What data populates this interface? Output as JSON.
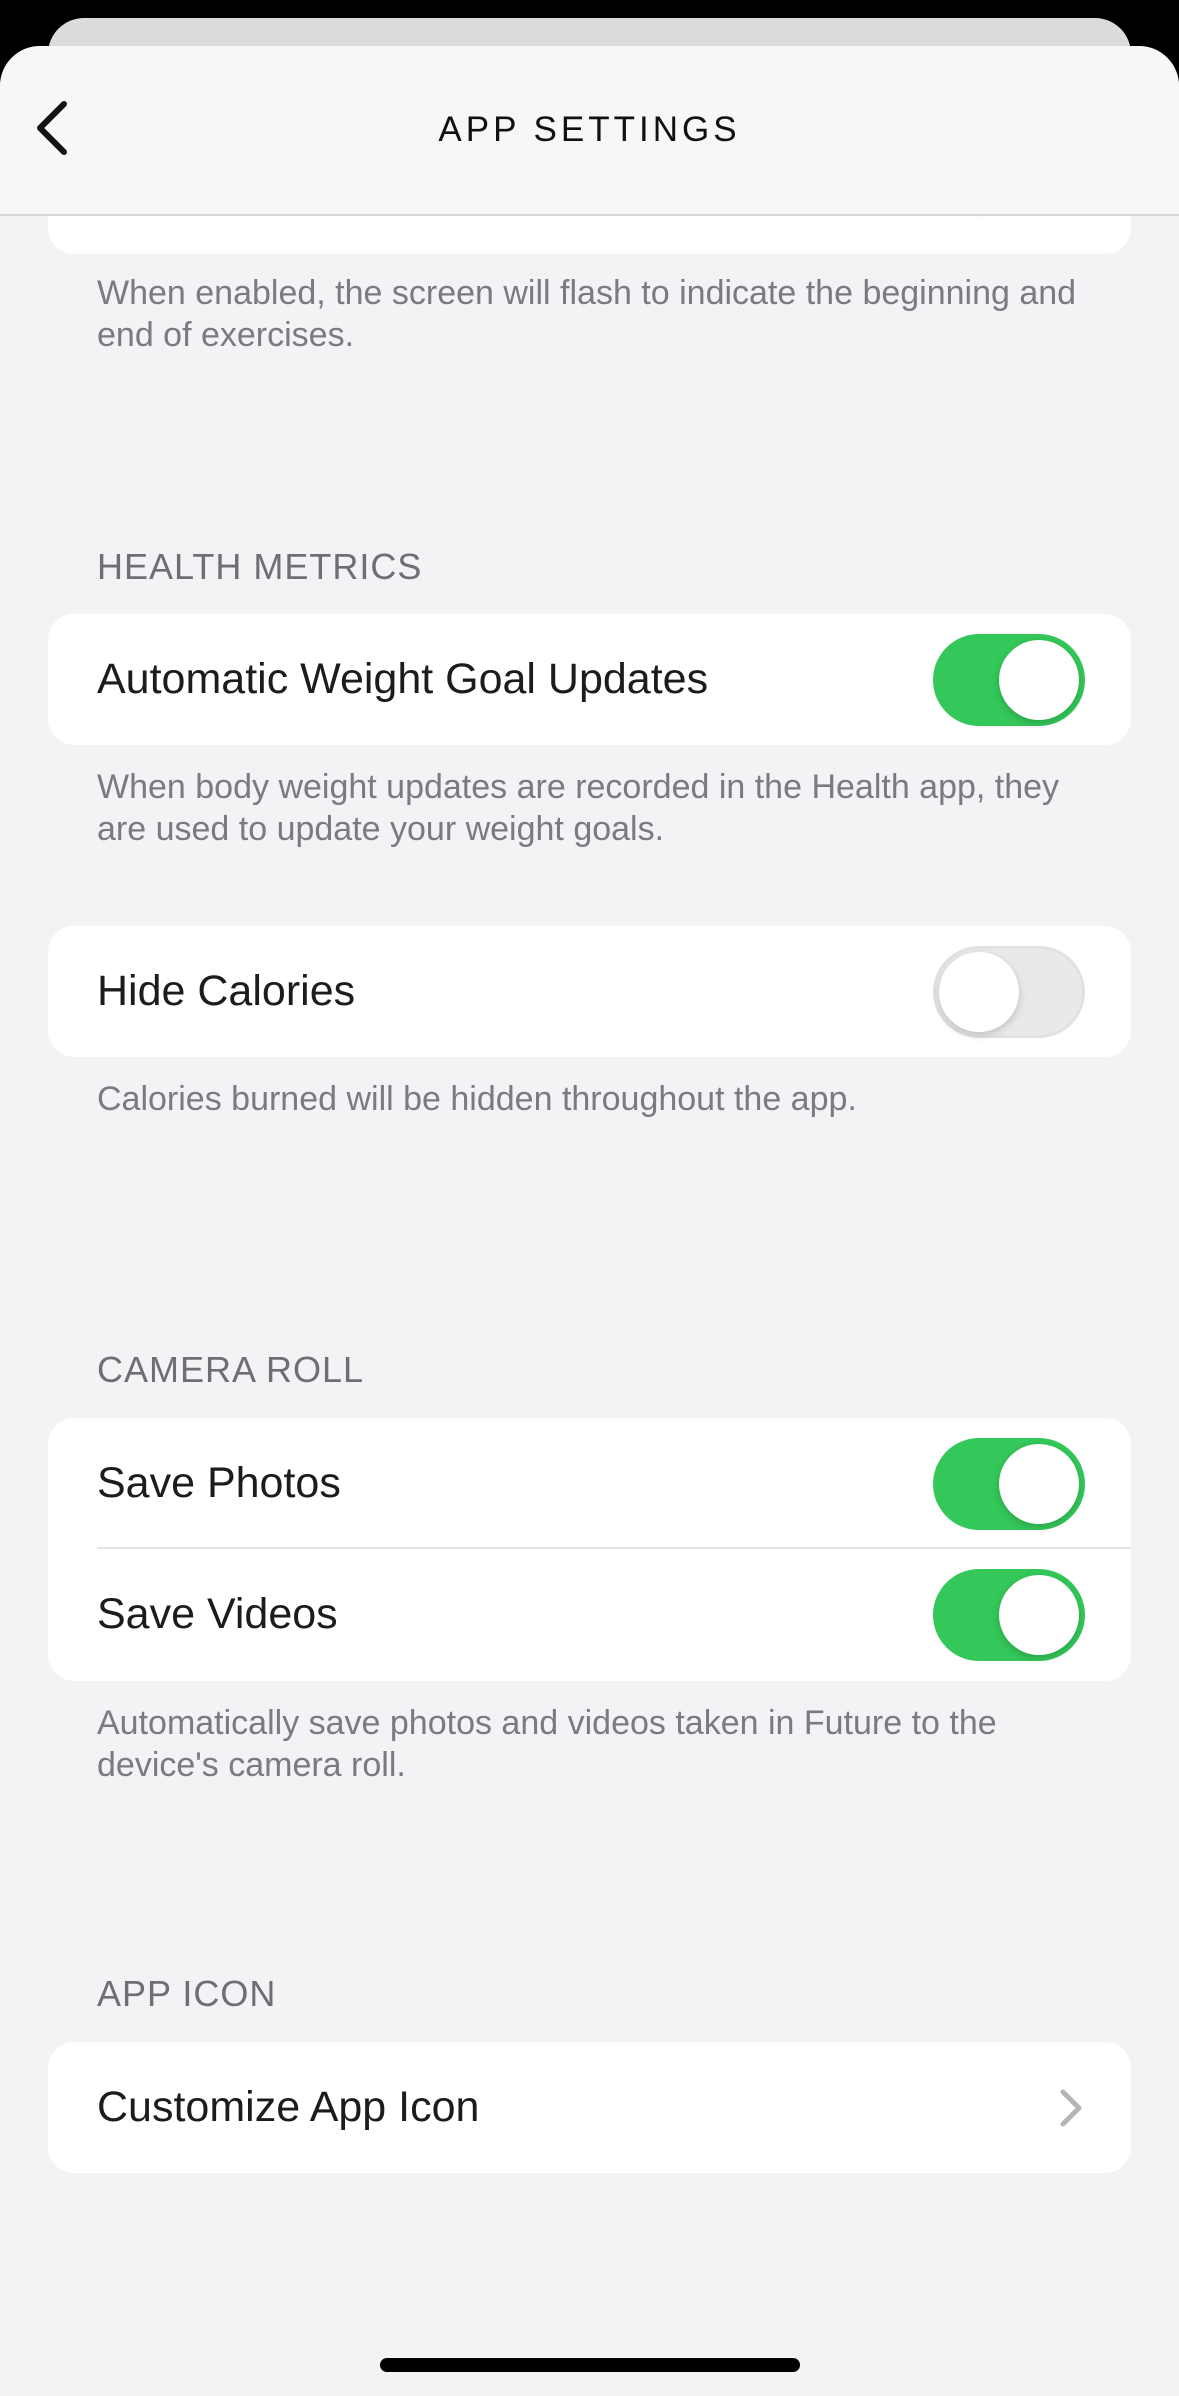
{
  "nav": {
    "title": "APP SETTINGS"
  },
  "flash": {
    "footnote": "When enabled, the screen will flash to indicate the beginning and end of exercises."
  },
  "health": {
    "header": "HEALTH METRICS",
    "weight_label": "Automatic Weight Goal Updates",
    "weight_on": true,
    "weight_footnote": "When body weight updates are recorded in the Health app, they are used to update your weight goals.",
    "calories_label": "Hide Calories",
    "calories_on": false,
    "calories_footnote": "Calories burned will be hidden throughout the app."
  },
  "camera": {
    "header": "CAMERA ROLL",
    "photos_label": "Save Photos",
    "photos_on": true,
    "videos_label": "Save Videos",
    "videos_on": true,
    "footnote": "Automatically save photos and videos taken in Future to the device's camera roll."
  },
  "app_icon": {
    "header": "APP ICON",
    "customize_label": "Customize App Icon"
  },
  "colors": {
    "toggle_on": "#34c759",
    "toggle_off": "#e9e9eb",
    "background": "#f2f3f5"
  }
}
